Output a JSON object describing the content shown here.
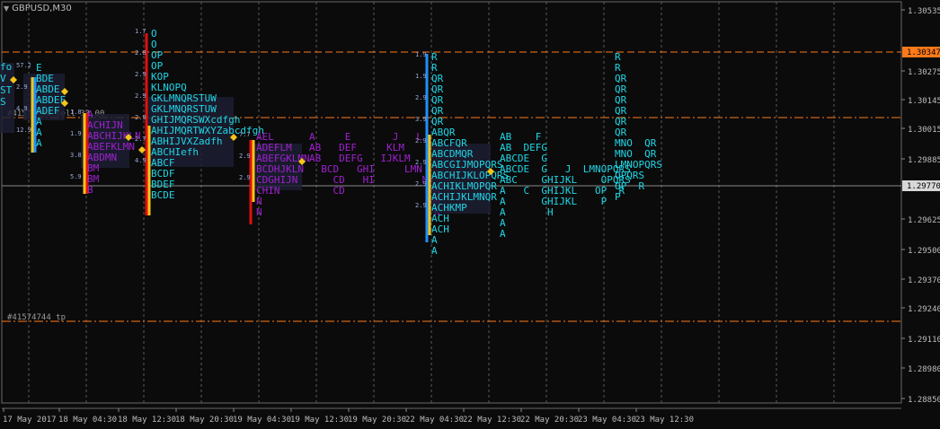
{
  "window": {
    "title": "GBPUSD,M30",
    "dropdown_icon": "triangle-down-icon"
  },
  "colors": {
    "background": "#0b0b0b",
    "grid": "#5a5a5a",
    "axis_text": "#bdbdbd",
    "bid_line": "#8a8a8a",
    "order_level": "#ff7a1a",
    "cyan_profile": "#1fd6e6",
    "purple_profile": "#a020d0",
    "poc_red": "#e01010",
    "poc_yellow": "#f5c518",
    "poc_blue": "#1e90ff",
    "value_area_bg": "#1c1f33",
    "marker_diamond": "#f5c518"
  },
  "price_axis": {
    "ticks": [
      "1.30535",
      "1.30275",
      "1.30145",
      "1.30015",
      "1.29885",
      "1.29625",
      "1.29500",
      "1.29370",
      "1.29240",
      "1.29110",
      "1.28980",
      "1.28850"
    ],
    "current_price": "1.30347",
    "bid_price": "1.29770"
  },
  "time_axis": {
    "labels": [
      "17 May 2017",
      "18 May 04:30",
      "18 May 12:30",
      "18 May 20:30",
      "19 May 04:30",
      "19 May 12:30",
      "19 May 20:30",
      "22 May 04:30",
      "22 May 12:30",
      "22 May 20:30",
      "23 May 04:30",
      "23 May 12:30"
    ]
  },
  "order_labels": {
    "sell_label": "#41574744 sell 33.00",
    "tp_label": "#41574744 tp"
  },
  "profiles": [
    {
      "name": "profile-1",
      "color": "cyan",
      "rows": [
        "fo",
        "V",
        "ST",
        "S"
      ],
      "numbers": []
    },
    {
      "name": "profile-2",
      "color": "cyan",
      "rows": [
        "E",
        "BDE",
        "ABDE",
        "ABDEF",
        "ADEF",
        "A",
        "A",
        "A"
      ],
      "numbers": [
        "57.2",
        "2.9",
        "4.9",
        "12.9"
      ]
    },
    {
      "name": "profile-3",
      "color": "purple",
      "rows": [
        "A",
        "ACHIJN",
        "ABCHIJKLN",
        "ABEFKLMN",
        "ABDMN",
        "BM",
        "BM",
        "B"
      ],
      "numbers": [
        "1.8",
        "1.9",
        "3.8",
        "5.9"
      ]
    },
    {
      "name": "profile-4",
      "color": "cyan",
      "rows": [
        "O",
        "O",
        "OP",
        "OP",
        "KOP",
        "KLNOPQ",
        "GKLMNQRSTUW",
        "GKLMNQRSTUW",
        "GHIJMQRSWXcdfgh",
        "AHIJMQRTWXYZabcdfgh",
        "ABHIJVXZadfh",
        "ABCHIefh",
        "ABCF",
        "BCDF",
        "BDEF",
        "BCDE"
      ],
      "numbers": [
        "1.7",
        "2.8",
        "2.9",
        "2.9",
        "2.9",
        "2.7",
        "4.9"
      ]
    },
    {
      "name": "profile-5",
      "color": "purple",
      "rows": [
        "AEL",
        "ADEFLM",
        "ABEFGKLMN",
        "BCDHJKLN",
        "CDGHIJN",
        "CHIN",
        "N",
        "N"
      ],
      "numbers": [
        "7.7",
        "2.9",
        "2.9"
      ]
    },
    {
      "name": "profile-6",
      "color": "purple",
      "rows": [
        "A     E       J   L",
        "AB   DEF     KLM",
        "AB   DEFG   IJKLM",
        "  BCD   GHI     LMN",
        "    CD   HI        MN",
        "    CD              MN",
        "                    MN",
        "                     N"
      ],
      "numbers": []
    },
    {
      "name": "profile-7",
      "color": "cyan",
      "rows": [
        "R",
        "R",
        "QR",
        "QR",
        "QR",
        "QR",
        "QR",
        "ABQR",
        "ABCFQR",
        "ABCDMQR",
        "ABCGIJMOPQRS",
        "ABCHIJKLOPQRS",
        "ACHIKLMOPQR",
        "ACHIJKLMNQR",
        "ACHKMP",
        "ACH",
        "ACH",
        "A",
        "A"
      ],
      "numbers": [
        "1.9",
        "1.9",
        "2.9",
        "3.9",
        "2.9",
        "2.9",
        "2.9",
        "2.9"
      ]
    },
    {
      "name": "profile-8",
      "color": "cyan",
      "rows": [
        "AB    F",
        "AB  DEFG",
        "ABCDE  G",
        "ABCDE  G   J  LMNOPQRS",
        "ABC    GHIJKL    OPQRS",
        "A   C  GHIJKL   OP  R",
        "A      GHIJKL    P",
        "A       H",
        "A",
        "A"
      ],
      "numbers": []
    },
    {
      "name": "profile-9",
      "color": "cyan",
      "rows": [
        "R",
        "R",
        "QR",
        "QR",
        "QR",
        "QR",
        "QR",
        "QR",
        "MNO  QR",
        "MNO  QR",
        "LMNOPQRS",
        "OPQRS",
        "OP  R",
        "P"
      ],
      "numbers": []
    }
  ]
}
